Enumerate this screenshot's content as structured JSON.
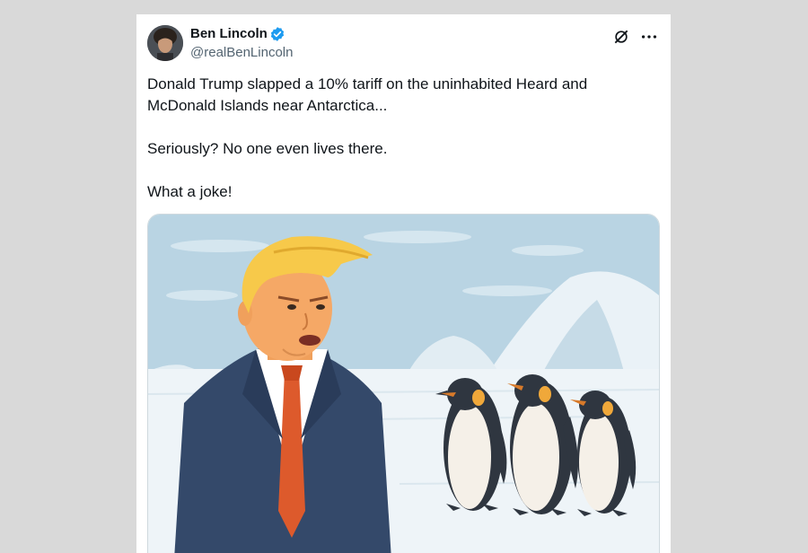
{
  "tweet": {
    "author": {
      "display_name": "Ben Lincoln",
      "handle": "@realBenLincoln",
      "verified_icon": "verified-badge-icon"
    },
    "actions": {
      "grok_icon": "grok-icon",
      "more_icon": "more-options-icon"
    },
    "text_lines": [
      "Donald Trump slapped a 10% tariff on the uninhabited Heard and McDonald Islands near Antarctica...",
      "Seriously? No one even lives there.",
      "What a joke!"
    ],
    "media": {
      "type": "illustration",
      "icon": "cartoon-image"
    }
  },
  "colors": {
    "page_bg": "#d9d9d9",
    "card_bg": "#ffffff",
    "text_primary": "#0f1419",
    "text_secondary": "#536471",
    "verified_blue": "#1d9bf0"
  }
}
